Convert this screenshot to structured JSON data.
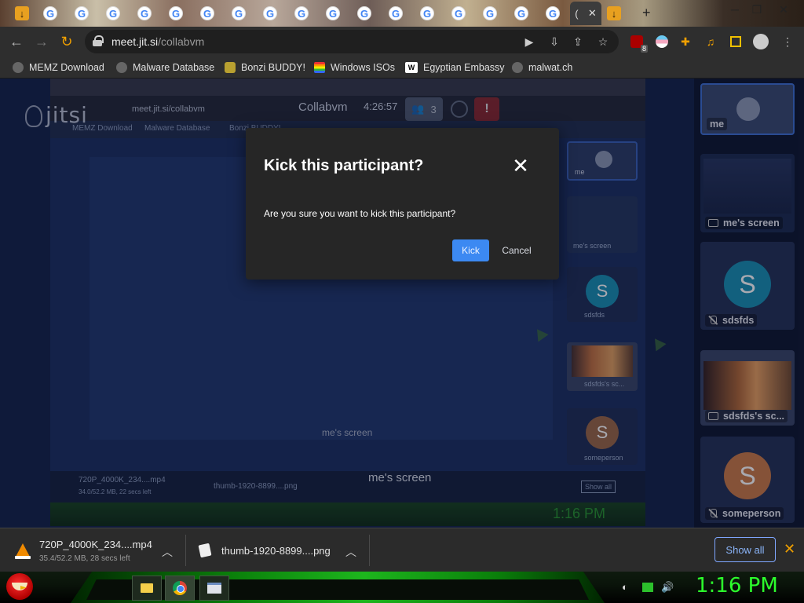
{
  "browser": {
    "url_host": "meet.jit.si",
    "url_path": "/collabvm",
    "profile_badge": "8"
  },
  "bookmarks": [
    {
      "label": "MEMZ Download",
      "icon": "globe-icon"
    },
    {
      "label": "Malware Database",
      "icon": "globe-icon"
    },
    {
      "label": "Bonzi BUDDY!",
      "icon": "bonzi-icon"
    },
    {
      "label": "Windows ISOs",
      "icon": "rainbow-icon"
    },
    {
      "label": "Egyptian Embassy",
      "icon": "wix-icon"
    },
    {
      "label": "malwat.ch",
      "icon": "globe-icon"
    }
  ],
  "meeting": {
    "title": "Collabvm",
    "timer": "4:26:57",
    "participant_count": "3",
    "brand": "jitsi"
  },
  "nested": {
    "url": "meet.jit.si/collabvm",
    "bm_memz": "MEMZ Download",
    "bm_malware": "Malware Database",
    "bm_bonzi": "Bonzi BUDDY!",
    "screen_label": "me's screen",
    "dl_name": "720P_4000K_234....mp4",
    "dl_sub": "34.0/52.2 MB, 22 secs left",
    "dl_png": "thumb-1920-8899....png",
    "show_all": "Show all",
    "clock": "1:16 PM",
    "tile_me": "me",
    "tile_me_screen": "me's screen",
    "tile_sdsfds": "sdsfds",
    "tile_sdsfds_screen": "sdsfds's sc...",
    "tile_someperson": "someperson"
  },
  "stage": {
    "screen_label": "me's screen"
  },
  "sidebar": {
    "tiles": [
      {
        "label": "me"
      },
      {
        "label": "me's screen"
      },
      {
        "label": "sdsfds",
        "initial": "S"
      },
      {
        "label": "sdsfds's sc..."
      },
      {
        "label": "someperson",
        "initial": "S"
      }
    ]
  },
  "modal": {
    "title": "Kick this participant?",
    "body": "Are you sure you want to kick this participant?",
    "confirm_label": "Kick",
    "cancel_label": "Cancel",
    "close_icon": "close-icon"
  },
  "downloads": {
    "items": [
      {
        "name": "720P_4000K_234....mp4",
        "status": "35.4/52.2 MB, 28 secs left",
        "icon": "vlc-icon"
      },
      {
        "name": "thumb-1920-8899....png",
        "icon": "file-icon"
      }
    ],
    "show_all_label": "Show all"
  },
  "taskbar": {
    "clock": "1:16 PM"
  },
  "colors": {
    "kick_button": "#3c89f2",
    "active_tile_border": "#3e6fd1",
    "avatar_blue": "#1a8fb2",
    "avatar_orange": "#c97a48",
    "clock_green": "#2cff2c"
  }
}
